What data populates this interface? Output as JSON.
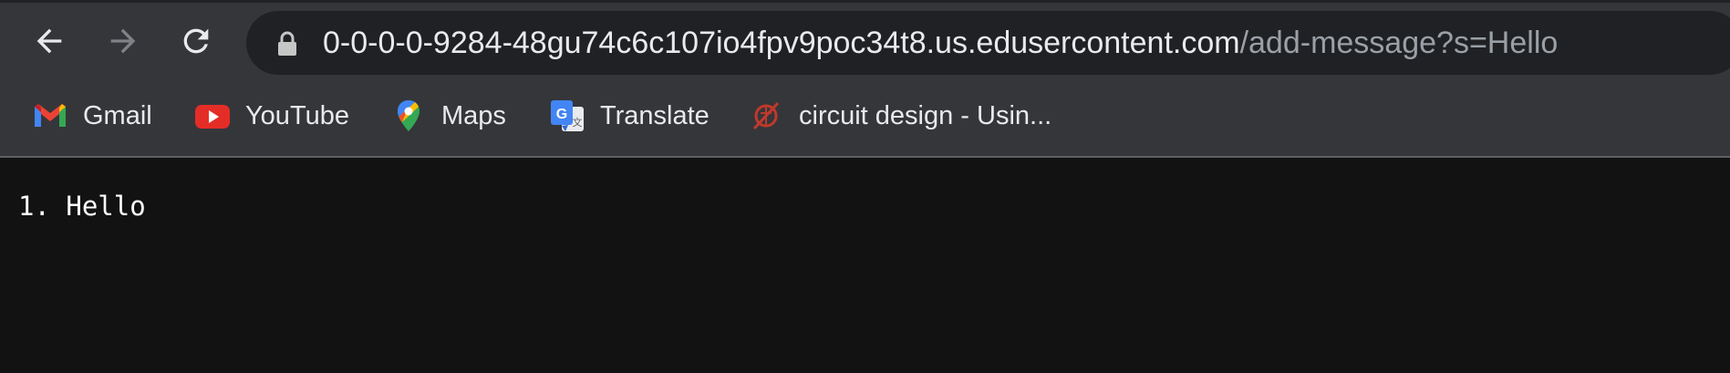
{
  "browser": {
    "nav": {
      "back_icon": "arrow-left-icon",
      "forward_icon": "arrow-right-icon",
      "reload_icon": "reload-icon"
    },
    "address_bar": {
      "secure_icon": "lock-icon",
      "host": "0-0-0-0-9284-48gu74c6c107io4fpv9poc34t8.us.edusercontent.com",
      "path": "/add-message?s=Hello"
    },
    "bookmarks": [
      {
        "label": "Gmail",
        "icon": "gmail-icon"
      },
      {
        "label": "YouTube",
        "icon": "youtube-icon"
      },
      {
        "label": "Maps",
        "icon": "maps-icon"
      },
      {
        "label": "Translate",
        "icon": "translate-icon"
      },
      {
        "label": "circuit design - Usin...",
        "icon": "circuit-icon"
      }
    ]
  },
  "page": {
    "messages": [
      {
        "number": "1.",
        "text": "Hello"
      }
    ]
  },
  "colors": {
    "toolbar_bg": "#35363a",
    "omnibox_bg": "#202124",
    "page_bg": "#121212",
    "text": "#e8eaed",
    "url_path": "#9aa0a6"
  }
}
